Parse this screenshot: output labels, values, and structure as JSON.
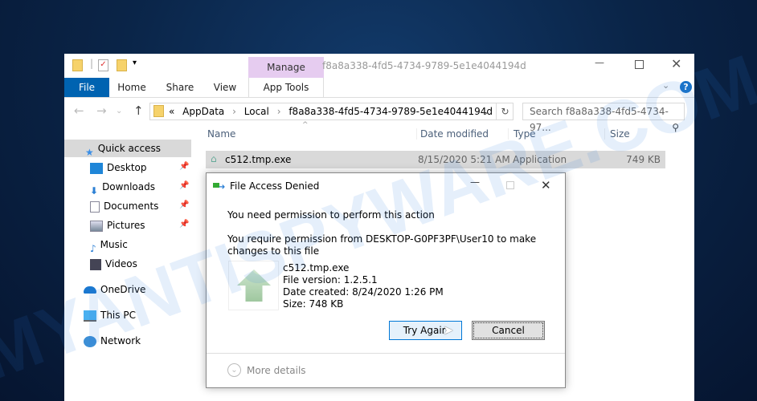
{
  "explorer": {
    "title": "f8a8a338-4fd5-4734-9789-5e1e4044194d",
    "contextual_group": "Manage",
    "tabs": [
      "File",
      "Home",
      "Share",
      "View",
      "App Tools"
    ],
    "address": {
      "prefix": "«",
      "crumbs": [
        "AppData",
        "Local",
        "f8a8a338-4fd5-4734-9789-5e1e4044194d"
      ]
    },
    "search_placeholder": "Search f8a8a338-4fd5-4734-97...",
    "columns": [
      "Name",
      "Date modified",
      "Type",
      "Size"
    ],
    "files": [
      {
        "name": "c512.tmp.exe",
        "date": "8/15/2020 5:21 AM",
        "type": "Application",
        "size": "749 KB"
      }
    ],
    "sidebar": [
      {
        "label": "Quick access",
        "icon": "star-icon"
      },
      {
        "label": "Desktop",
        "icon": "desktop-icon",
        "pinned": true
      },
      {
        "label": "Downloads",
        "icon": "download-icon",
        "pinned": true
      },
      {
        "label": "Documents",
        "icon": "documents-icon",
        "pinned": true
      },
      {
        "label": "Pictures",
        "icon": "pictures-icon",
        "pinned": true
      },
      {
        "label": "Music",
        "icon": "music-icon"
      },
      {
        "label": "Videos",
        "icon": "videos-icon"
      },
      {
        "label": "OneDrive",
        "icon": "cloud-icon"
      },
      {
        "label": "This PC",
        "icon": "computer-icon"
      },
      {
        "label": "Network",
        "icon": "network-icon"
      }
    ],
    "help": "?"
  },
  "dialog": {
    "title": "File Access Denied",
    "heading": "You need permission to perform this action",
    "message": "You require permission from DESKTOP-G0PF3PF\\User10 to make changes to this file",
    "file": {
      "name": "c512.tmp.exe",
      "version": "File version: 1.2.5.1",
      "created": "Date created: 8/24/2020 1:26 PM",
      "size": "Size: 748 KB"
    },
    "try_again": "Try Again",
    "cancel": "Cancel",
    "more_details": "More details"
  },
  "watermark": "MYANTISPYWARE.COM",
  "colors": {
    "accent": "#0063b1",
    "selection": "#d9d9d9",
    "manage": "#e6ccf0"
  }
}
